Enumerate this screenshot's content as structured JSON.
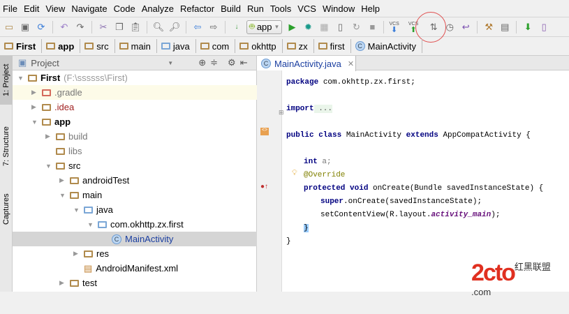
{
  "menu": [
    "File",
    "Edit",
    "View",
    "Navigate",
    "Code",
    "Analyze",
    "Refactor",
    "Build",
    "Run",
    "Tools",
    "VCS",
    "Window",
    "Help"
  ],
  "toolbar": {
    "run_config": "app",
    "vcs_update": "VCS",
    "vcs_commit": "VCS"
  },
  "breadcrumbs": [
    "First",
    "app",
    "src",
    "main",
    "java",
    "com",
    "okhttp",
    "zx",
    "first",
    "MainActivity"
  ],
  "side_tabs": [
    "1: Project",
    "7: Structure",
    "Captures"
  ],
  "project": {
    "view_label": "Project",
    "tree": [
      {
        "label": "First",
        "path": "(F:\\ssssss\\First)",
        "depth": 0,
        "arrow": "▼"
      },
      {
        "label": ".gradle",
        "depth": 1,
        "arrow": "▶"
      },
      {
        "label": ".idea",
        "depth": 1,
        "arrow": "▶"
      },
      {
        "label": "app",
        "depth": 1,
        "arrow": "▼"
      },
      {
        "label": "build",
        "depth": 2,
        "arrow": "▶"
      },
      {
        "label": "libs",
        "depth": 2,
        "arrow": ""
      },
      {
        "label": "src",
        "depth": 2,
        "arrow": "▼"
      },
      {
        "label": "androidTest",
        "depth": 3,
        "arrow": "▶"
      },
      {
        "label": "main",
        "depth": 3,
        "arrow": "▼"
      },
      {
        "label": "java",
        "depth": 4,
        "arrow": "▼"
      },
      {
        "label": "com.okhttp.zx.first",
        "depth": 5,
        "arrow": "▼"
      },
      {
        "label": "MainActivity",
        "depth": 6,
        "arrow": ""
      },
      {
        "label": "res",
        "depth": 4,
        "arrow": "▶"
      },
      {
        "label": "AndroidManifest.xml",
        "depth": 4,
        "arrow": ""
      },
      {
        "label": "test",
        "depth": 3,
        "arrow": "▶"
      }
    ]
  },
  "editor": {
    "tab": "MainActivity.java",
    "code": {
      "l1a": "package",
      " l1b": "",
      "l1c": " com.okhttp.zx.first;",
      "l2a": "import",
      "l2b": " ...",
      "l3a": "public class",
      "l3b": " MainActivity ",
      "l3c": "extends",
      "l3d": " AppCompatActivity {",
      "l4a": "int",
      "l4b": " a;",
      "l5": "@Override",
      "l6a": "protected void",
      "l6b": " onCreate(Bundle savedInstanceState) {",
      "l7a": "super",
      "l7b": ".onCreate(savedInstanceState);",
      "l8a": "setContentView(R.layout.",
      "l8b": "activity_main",
      "l8c": ");",
      "l9": "}",
      "l10": "}"
    }
  },
  "watermark": {
    "logo": "2cto",
    "sub": "红黑联盟 .com"
  }
}
